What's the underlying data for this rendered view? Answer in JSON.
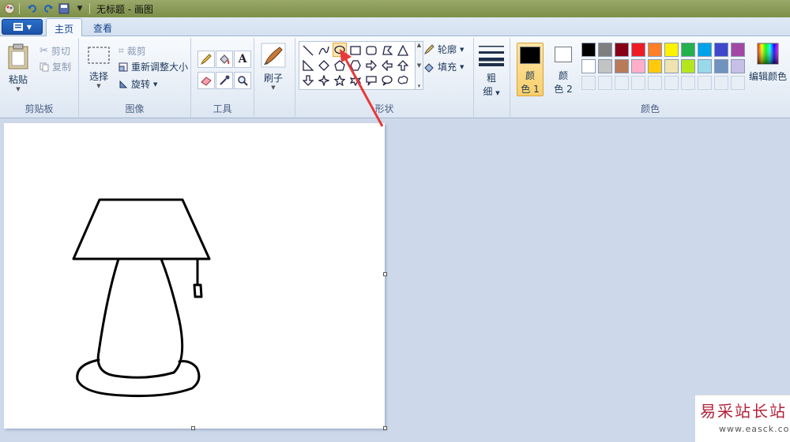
{
  "titlebar": {
    "title": "无标题 - 画图"
  },
  "tabs": {
    "home": "主页",
    "view": "查看"
  },
  "clipboard": {
    "paste": "粘贴",
    "cut": "剪切",
    "copy": "复制",
    "label": "剪贴板"
  },
  "image": {
    "select": "选择",
    "crop": "裁剪",
    "resize": "重新调整大小",
    "rotate": "旋转",
    "label": "图像"
  },
  "tools": {
    "label": "工具"
  },
  "brushes": {
    "label": "刷子"
  },
  "shapes": {
    "outline": "轮廓",
    "fill": "填充",
    "label": "形状"
  },
  "size": {
    "label_line1": "粗",
    "label_line2": "细"
  },
  "colors": {
    "color1_line1": "颜",
    "color1_line2": "色 1",
    "color2_line1": "颜",
    "color2_line2": "色 2",
    "edit": "编辑颜色",
    "label": "颜色",
    "color1_value": "#000000",
    "color2_value": "#ffffff",
    "palette_row1": [
      "#000000",
      "#7f7f7f",
      "#880015",
      "#ed1c24",
      "#ff7f27",
      "#fff200",
      "#22b14c",
      "#00a2e8",
      "#3f48cc",
      "#a349a4"
    ],
    "palette_row2": [
      "#ffffff",
      "#c3c3c3",
      "#b97a57",
      "#ffaec9",
      "#ffc90e",
      "#efe4b0",
      "#b5e61d",
      "#99d9ea",
      "#7092be",
      "#c8bfe7"
    ]
  },
  "watermark": {
    "title": "易采站长站",
    "url": "www.easck.com"
  }
}
